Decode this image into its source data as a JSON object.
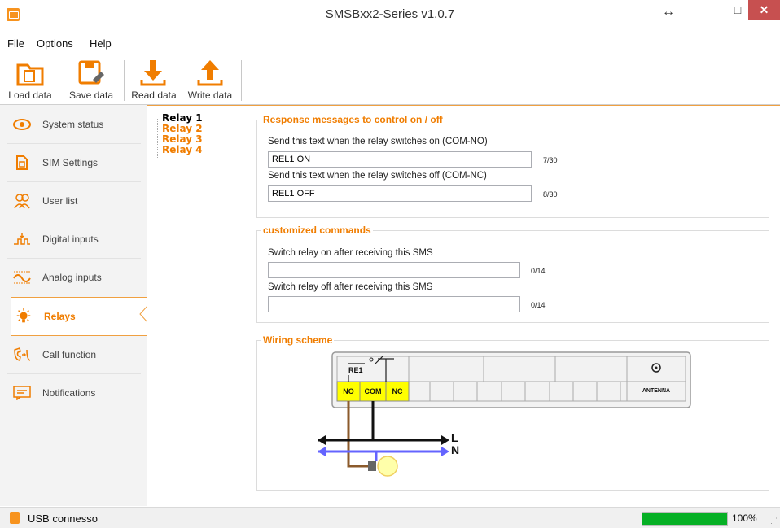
{
  "window": {
    "title": "SMSBxx2-Series v1.0.7",
    "icon": "app-icon"
  },
  "menu": [
    "File",
    "Options",
    "Help"
  ],
  "toolbar": {
    "load": "Load data",
    "save": "Save data",
    "read": "Read data",
    "write": "Write data"
  },
  "sidebar": [
    {
      "label": "System status",
      "icon": "eye-icon"
    },
    {
      "label": "SIM Settings",
      "icon": "sim-icon"
    },
    {
      "label": "User list",
      "icon": "users-icon"
    },
    {
      "label": "Digital inputs",
      "icon": "digital-input-icon"
    },
    {
      "label": "Analog inputs",
      "icon": "analog-input-icon"
    },
    {
      "label": "Relays",
      "icon": "bulb-icon",
      "active": true
    },
    {
      "label": "Call function",
      "icon": "call-icon"
    },
    {
      "label": "Notifications",
      "icon": "message-icon"
    }
  ],
  "relays": [
    "Relay 1",
    "Relay 2",
    "Relay 3",
    "Relay 4"
  ],
  "response": {
    "title": "Response messages to control on / off",
    "on_label": "Send this text when the relay switches on (COM-NO)",
    "on_value": "REL1 ON",
    "on_count": "7/30",
    "off_label": "Send this text when the relay switches off (COM-NC)",
    "off_value": "REL1 OFF",
    "off_count": "8/30"
  },
  "commands": {
    "title": "customized commands",
    "on_label": "Switch relay on after receiving this SMS",
    "on_value": "",
    "on_count": "0/14",
    "off_label": "Switch relay off after receiving this SMS",
    "off_value": "",
    "off_count": "0/14"
  },
  "wiring": {
    "title": "Wiring scheme",
    "relay": "RE1",
    "no": "NO",
    "com": "COM",
    "nc": "NC",
    "antenna": "ANTENNA",
    "l": "L",
    "n": "N"
  },
  "status": {
    "text": "USB connesso",
    "progress": 100,
    "progress_text": "100%"
  },
  "colors": {
    "accent": "#f07d00",
    "terminal": "#ffff00",
    "progress": "#06b025",
    "neutral_wire": "#6464ff",
    "load_wire": "#8b5a2b"
  }
}
